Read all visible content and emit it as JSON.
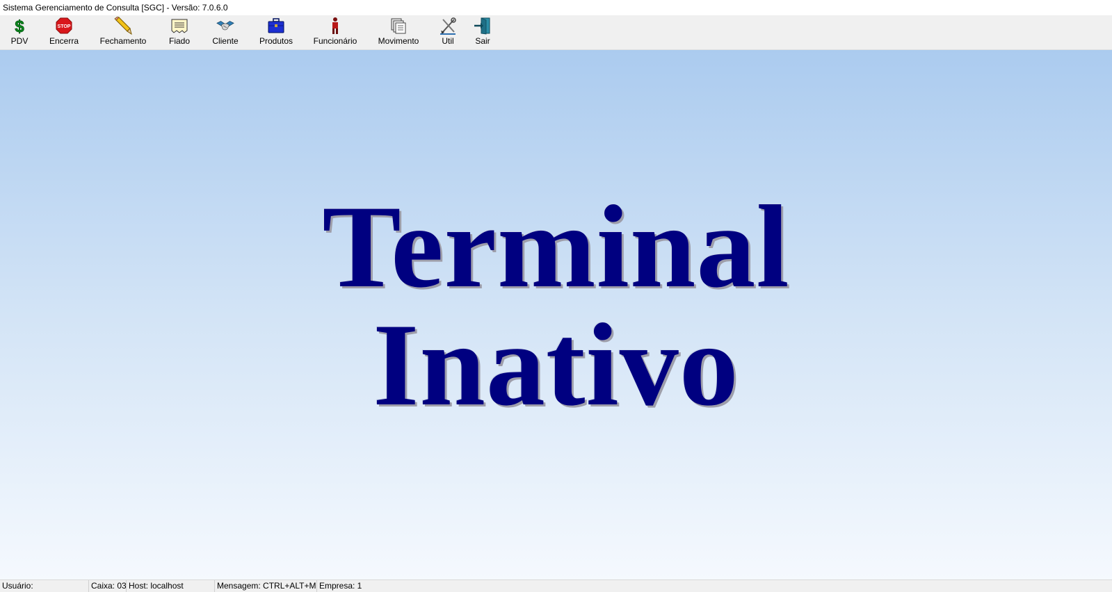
{
  "window": {
    "title": "Sistema Gerenciamento de Consulta [SGC] -  Versão: 7.0.6.0"
  },
  "toolbar": {
    "items": [
      {
        "id": "pdv",
        "label": "PDV",
        "icon": "dollar-icon"
      },
      {
        "id": "encerra",
        "label": "Encerra",
        "icon": "stop-sign-icon"
      },
      {
        "id": "fechamento",
        "label": "Fechamento",
        "icon": "pencil-icon"
      },
      {
        "id": "fiado",
        "label": "Fiado",
        "icon": "note-icon"
      },
      {
        "id": "cliente",
        "label": "Cliente",
        "icon": "handshake-icon"
      },
      {
        "id": "produtos",
        "label": "Produtos",
        "icon": "briefcase-icon"
      },
      {
        "id": "funcionario",
        "label": "Funcionário",
        "icon": "person-icon"
      },
      {
        "id": "movimento",
        "label": "Movimento",
        "icon": "documents-icon"
      },
      {
        "id": "util",
        "label": "Util",
        "icon": "tools-icon"
      },
      {
        "id": "sair",
        "label": "Sair",
        "icon": "exit-door-icon"
      }
    ]
  },
  "main": {
    "line1": "Terminal",
    "line2": "Inativo",
    "text_color": "#000080"
  },
  "statusbar": {
    "usuario": "Usuário:",
    "caixa": "Caixa: 03",
    "host": "Host: localhost",
    "mensagem": "Mensagem: CTRL+ALT+M",
    "empresa": "Empresa: 1"
  }
}
